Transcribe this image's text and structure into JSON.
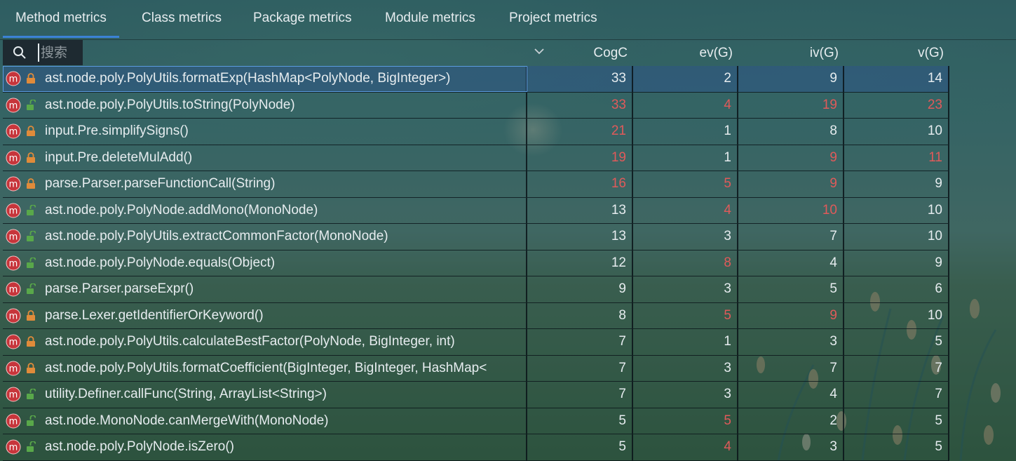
{
  "tabs": [
    {
      "label": "Method metrics",
      "active": true
    },
    {
      "label": "Class metrics",
      "active": false
    },
    {
      "label": "Package metrics",
      "active": false
    },
    {
      "label": "Module metrics",
      "active": false
    },
    {
      "label": "Project metrics",
      "active": false
    }
  ],
  "search": {
    "placeholder": "搜索",
    "value": ""
  },
  "columns": {
    "cogc": "CogC",
    "evg": "ev(G)",
    "ivg": "iv(G)",
    "vg": "v(G)"
  },
  "colors": {
    "accent": "#3b82d6",
    "warning": "#e05a5a",
    "method_icon": "#c7353b",
    "lock_private": "#e08b3a",
    "lock_public": "#59a84a"
  },
  "rows": [
    {
      "name": "ast.node.poly.PolyUtils.formatExp(HashMap<PolyNode, BigInteger>)",
      "access": "private",
      "cogc": "33",
      "evg": "2",
      "ivg": "9",
      "vg": "14",
      "warn": [
        false,
        false,
        false,
        false
      ],
      "selected": true
    },
    {
      "name": "ast.node.poly.PolyUtils.toString(PolyNode)",
      "access": "public",
      "cogc": "33",
      "evg": "4",
      "ivg": "19",
      "vg": "23",
      "warn": [
        true,
        true,
        true,
        true
      ]
    },
    {
      "name": "input.Pre.simplifySigns()",
      "access": "private",
      "cogc": "21",
      "evg": "1",
      "ivg": "8",
      "vg": "10",
      "warn": [
        true,
        false,
        false,
        false
      ]
    },
    {
      "name": "input.Pre.deleteMulAdd()",
      "access": "private",
      "cogc": "19",
      "evg": "1",
      "ivg": "9",
      "vg": "11",
      "warn": [
        true,
        false,
        true,
        true
      ]
    },
    {
      "name": "parse.Parser.parseFunctionCall(String)",
      "access": "private",
      "cogc": "16",
      "evg": "5",
      "ivg": "9",
      "vg": "9",
      "warn": [
        true,
        true,
        true,
        false
      ]
    },
    {
      "name": "ast.node.poly.PolyNode.addMono(MonoNode)",
      "access": "public",
      "cogc": "13",
      "evg": "4",
      "ivg": "10",
      "vg": "10",
      "warn": [
        false,
        true,
        true,
        false
      ]
    },
    {
      "name": "ast.node.poly.PolyUtils.extractCommonFactor(MonoNode)",
      "access": "public",
      "cogc": "13",
      "evg": "3",
      "ivg": "7",
      "vg": "10",
      "warn": [
        false,
        false,
        false,
        false
      ]
    },
    {
      "name": "ast.node.poly.PolyNode.equals(Object)",
      "access": "public",
      "cogc": "12",
      "evg": "8",
      "ivg": "4",
      "vg": "9",
      "warn": [
        false,
        true,
        false,
        false
      ]
    },
    {
      "name": "parse.Parser.parseExpr()",
      "access": "public",
      "cogc": "9",
      "evg": "3",
      "ivg": "5",
      "vg": "6",
      "warn": [
        false,
        false,
        false,
        false
      ]
    },
    {
      "name": "parse.Lexer.getIdentifierOrKeyword()",
      "access": "private",
      "cogc": "8",
      "evg": "5",
      "ivg": "9",
      "vg": "10",
      "warn": [
        false,
        true,
        true,
        false
      ]
    },
    {
      "name": "ast.node.poly.PolyUtils.calculateBestFactor(PolyNode, BigInteger, int)",
      "access": "private",
      "cogc": "7",
      "evg": "1",
      "ivg": "3",
      "vg": "5",
      "warn": [
        false,
        false,
        false,
        false
      ]
    },
    {
      "name": "ast.node.poly.PolyUtils.formatCoefficient(BigInteger, BigInteger, HashMap<",
      "access": "private",
      "cogc": "7",
      "evg": "3",
      "ivg": "7",
      "vg": "7",
      "warn": [
        false,
        false,
        false,
        false
      ]
    },
    {
      "name": "utility.Definer.callFunc(String, ArrayList<String>)",
      "access": "public",
      "cogc": "7",
      "evg": "3",
      "ivg": "4",
      "vg": "7",
      "warn": [
        false,
        false,
        false,
        false
      ]
    },
    {
      "name": "ast.node.MonoNode.canMergeWith(MonoNode)",
      "access": "public",
      "cogc": "5",
      "evg": "5",
      "ivg": "2",
      "vg": "5",
      "warn": [
        false,
        true,
        false,
        false
      ]
    },
    {
      "name": "ast.node.poly.PolyNode.isZero()",
      "access": "public",
      "cogc": "5",
      "evg": "4",
      "ivg": "3",
      "vg": "5",
      "warn": [
        false,
        true,
        false,
        false
      ]
    }
  ]
}
